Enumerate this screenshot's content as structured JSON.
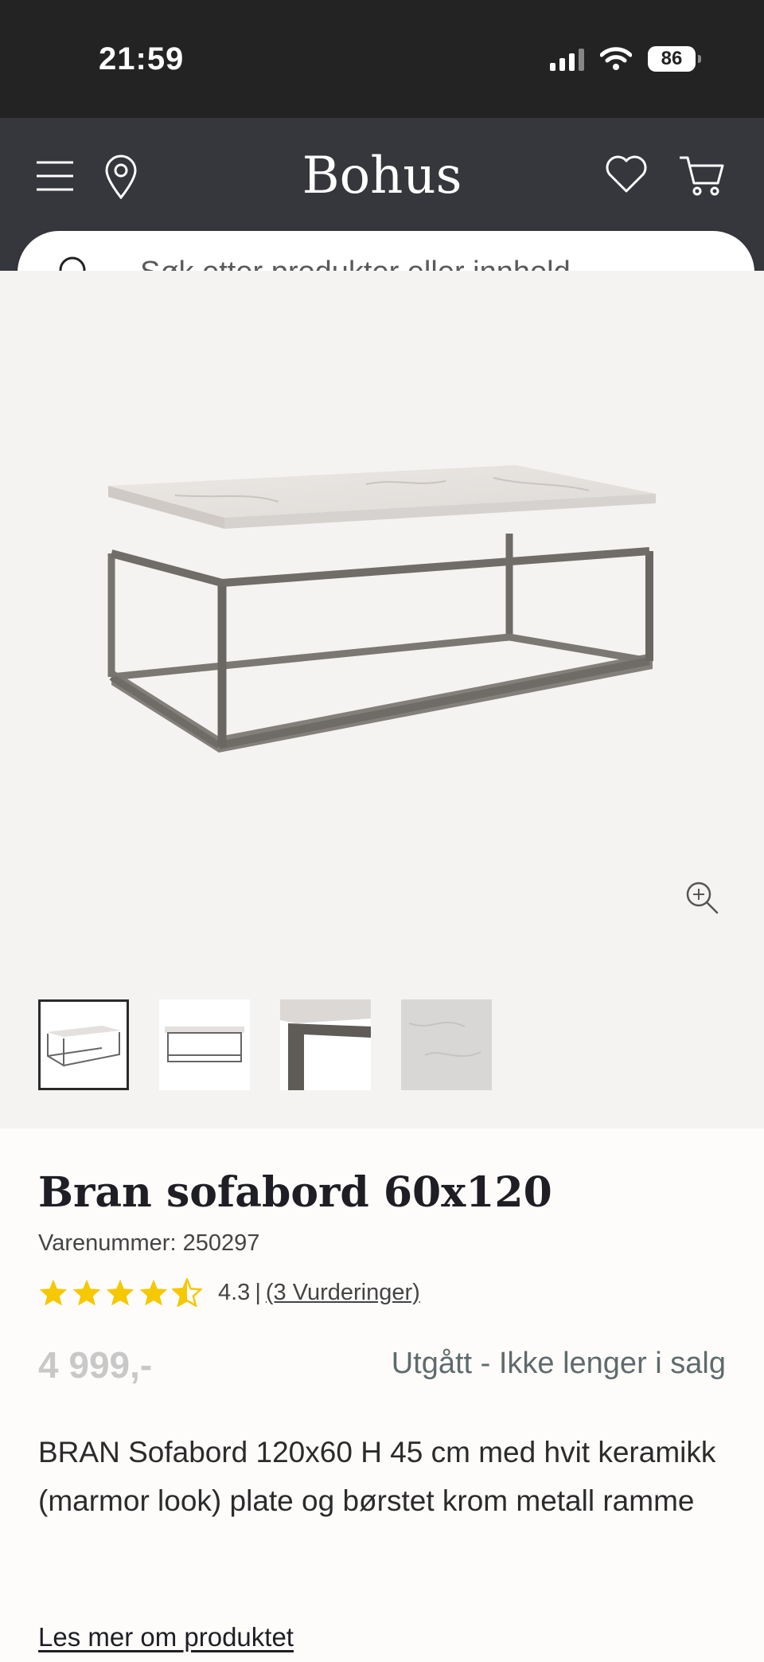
{
  "status_bar": {
    "time": "21:59",
    "battery": "86",
    "icons": [
      "signal-icon",
      "wifi-icon",
      "battery-icon"
    ]
  },
  "header": {
    "logo": "Bohus",
    "icons": [
      "menu-icon",
      "location-pin-icon",
      "heart-icon",
      "cart-icon"
    ],
    "colors": {
      "background": "#36363d",
      "status_bar": "#232323"
    }
  },
  "search": {
    "placeholder": "Søk etter produkter eller innhold..."
  },
  "gallery": {
    "thumbnail_count": 4,
    "active_thumbnail": 1,
    "icons": [
      "zoom-in-icon"
    ]
  },
  "product": {
    "title": "Bran sofabord 60x120",
    "sku": "Varenummer: 250297",
    "rating": {
      "value": "4.3",
      "stars_filled": 4.5,
      "stars_total": 5,
      "separator": "|",
      "reviews_link": "(3 Vurderinger)",
      "star_color": "#f5c800"
    },
    "price": "4 999,-",
    "availability": "Utgått - Ikke lenger i salg",
    "description": "BRAN Sofabord 120x60 H 45 cm med hvit keramikk (marmor look) plate og børstet krom metall ramme",
    "read_more": "Les mer om produktet"
  }
}
